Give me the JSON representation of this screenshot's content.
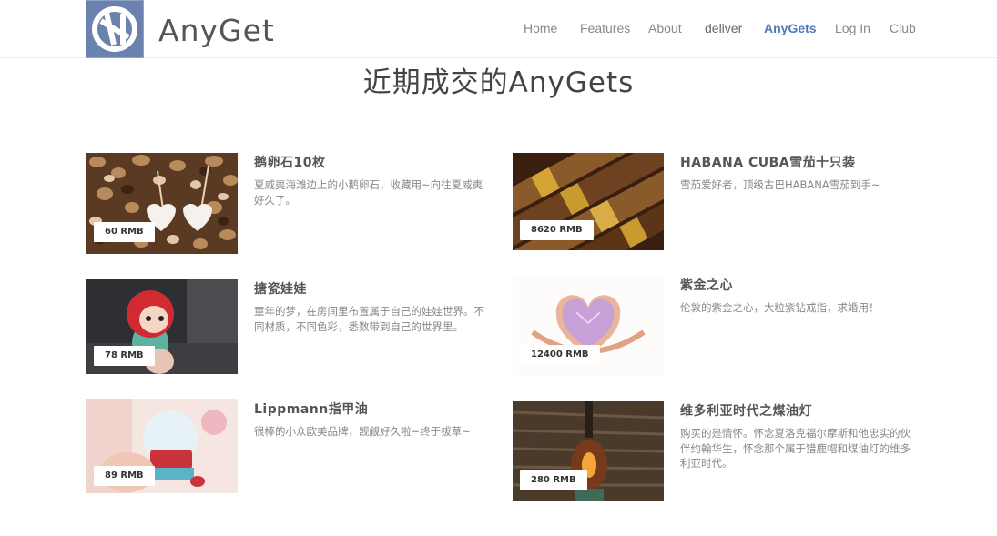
{
  "header": {
    "brand": "AnyGet",
    "nav": [
      {
        "label": "Home"
      },
      {
        "label": "Features"
      },
      {
        "label": "About"
      },
      {
        "label": "deliver"
      },
      {
        "label": "AnyGets"
      },
      {
        "label": "Log In"
      },
      {
        "label": "Club"
      }
    ],
    "active_nav": "AnyGets",
    "accent_color": "#4f7ab8",
    "logo_color": "#6a82ad"
  },
  "main": {
    "title": "近期成交的AnyGets",
    "items": [
      {
        "title": "鹅卵石10枚",
        "description": "夏威夷海滩边上的小鹅卵石，收藏用~向往夏威夷好久了。",
        "price": "60 RMB",
        "image": "pebbles-with-hearts"
      },
      {
        "title": "HABANA CUBA雪茄十只装",
        "description": "雪茄爱好者，顶级古巴HABANA雪茄到手~",
        "price": "8620 RMB",
        "image": "cigars"
      },
      {
        "title": "搪瓷娃娃",
        "description": "童年的梦，在房间里布置属于自己的娃娃世界。不同材质，不同色彩，悉数带到自己的世界里。",
        "price": "78 RMB",
        "image": "doll-figurine"
      },
      {
        "title": "紫金之心",
        "description": "伦敦的紫金之心，大粒紫钻戒指，求婚用！",
        "price": "12400 RMB",
        "image": "purple-heart-ring"
      },
      {
        "title": "Lippmann指甲油",
        "description": "很棒的小众欧美品牌，觊觎好久啦~终于拔草~",
        "price": "89 RMB",
        "image": "snow-globe-bus"
      },
      {
        "title": "维多利亚时代之煤油灯",
        "description": "购买的是情怀。怀念夏洛克福尔摩斯和他忠实的伙伴约翰华生，怀念那个属于猎鹿帽和煤油灯的维多利亚时代。",
        "price": "280 RMB",
        "image": "kerosene-lamp"
      }
    ]
  }
}
